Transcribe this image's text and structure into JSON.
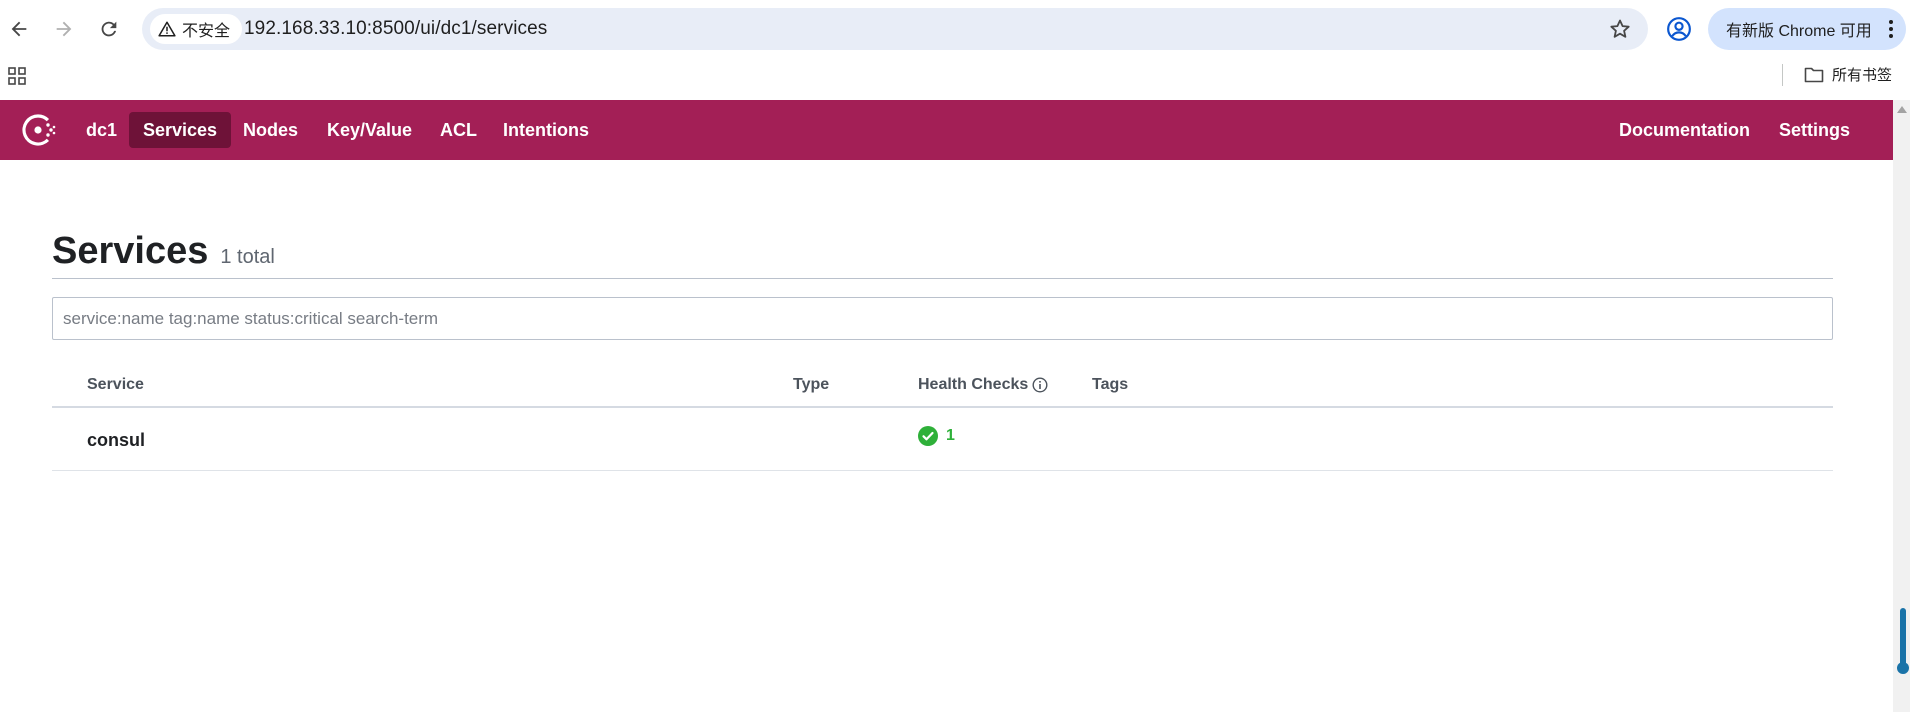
{
  "browser": {
    "security_label": "不安全",
    "url": "192.168.33.10:8500/ui/dc1/services",
    "update_label": "有新版 Chrome 可用",
    "bookmarks_folder": "所有书签"
  },
  "header": {
    "datacenter": "dc1",
    "nav": [
      "Services",
      "Nodes",
      "Key/Value",
      "ACL",
      "Intentions"
    ],
    "active": "Services",
    "right_links": [
      "Documentation",
      "Settings"
    ],
    "brand_color": "#a31f56"
  },
  "page": {
    "title": "Services",
    "count": "1 total"
  },
  "search": {
    "placeholder": "service:name tag:name status:critical search-term"
  },
  "table": {
    "columns": [
      "Service",
      "Type",
      "Health Checks",
      "Tags"
    ],
    "rows": [
      {
        "service": "consul",
        "type": "",
        "health_passing": "1",
        "tags": ""
      }
    ]
  },
  "icons": {
    "health_info": "info-icon",
    "passing": "check-circle-icon",
    "passing_color": "#2eb039"
  }
}
